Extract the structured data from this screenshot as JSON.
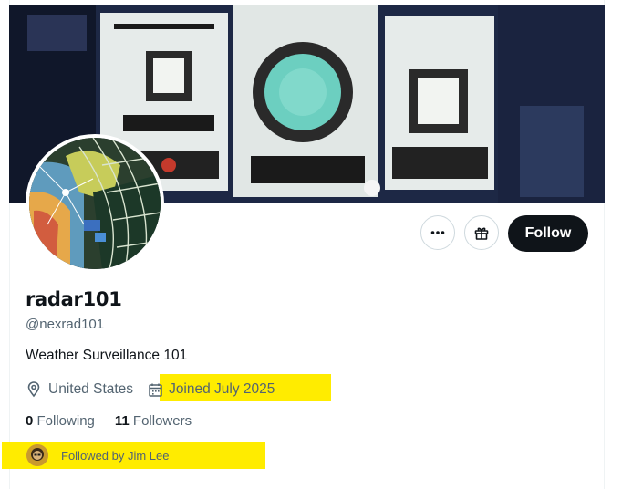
{
  "profile": {
    "display_name": "radar101",
    "handle": "@nexrad101",
    "bio": "Weather Surveillance 101",
    "location": "United States",
    "joined": "Joined July 2025"
  },
  "actions": {
    "more_icon": "more-dots-icon",
    "gift_icon": "gift-icon",
    "follow_label": "Follow"
  },
  "stats": {
    "following_count": "0",
    "following_label": "Following",
    "followers_count": "11",
    "followers_label": "Followers"
  },
  "followed_by": {
    "text": "Followed by Jim Lee"
  },
  "colors": {
    "highlight": "#ffec00",
    "follow_button": "#0f1419",
    "secondary_text": "#536471"
  }
}
